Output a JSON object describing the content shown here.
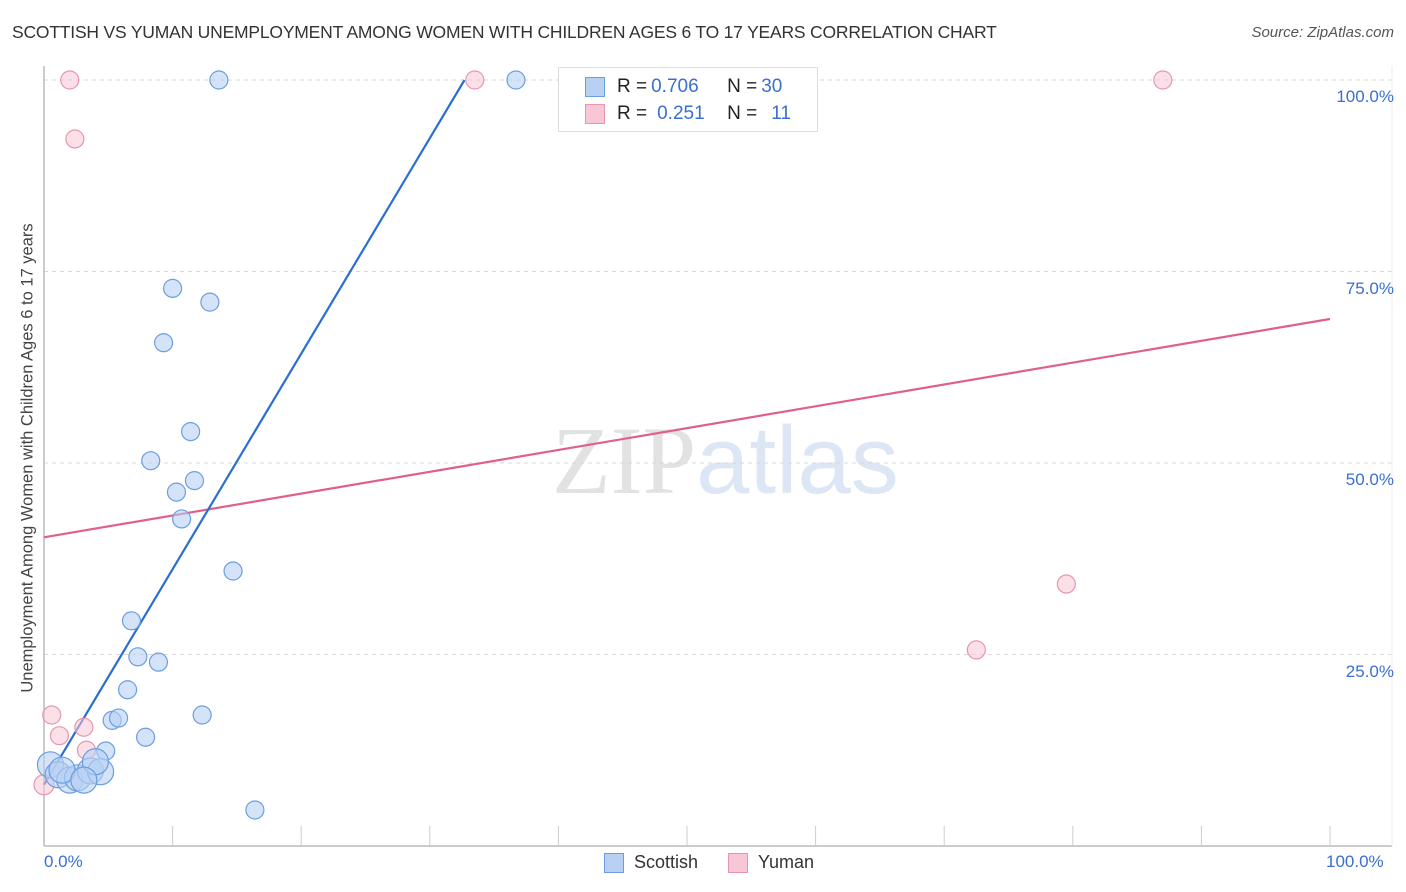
{
  "header": {
    "title": "SCOTTISH VS YUMAN UNEMPLOYMENT AMONG WOMEN WITH CHILDREN AGES 6 TO 17 YEARS CORRELATION CHART",
    "source": "Source: ZipAtlas.com"
  },
  "watermark": {
    "zip": "ZIP",
    "atlas": "atlas"
  },
  "legend": {
    "rows": [
      {
        "r_label": "R = ",
        "r_value": "0.706",
        "n_label": "N = ",
        "n_value": "30"
      },
      {
        "r_label": "R = ",
        "r_value": "0.251",
        "n_label": "N = ",
        "n_value": "11"
      }
    ]
  },
  "colors": {
    "scottish_fill": "#b8d1f3",
    "scottish_stroke": "#6a9ee0",
    "scottish_line": "#2a6fd0",
    "yuman_fill": "#f8c6d4",
    "yuman_stroke": "#e896b0",
    "yuman_line": "#e0608a",
    "tick_text": "#3a6fd0"
  },
  "chart_data": {
    "type": "scatter",
    "title": "SCOTTISH VS YUMAN UNEMPLOYMENT AMONG WOMEN WITH CHILDREN AGES 6 TO 17 YEARS CORRELATION CHART",
    "xlabel": "",
    "ylabel": "Unemployment Among Women with Children Ages 6 to 17 years",
    "xlim": [
      0,
      100
    ],
    "ylim": [
      0,
      100
    ],
    "x_tick_labels": [
      "0.0%",
      "100.0%"
    ],
    "y_ticks": [
      25,
      50,
      75,
      100
    ],
    "y_tick_labels": [
      "25.0%",
      "50.0%",
      "75.0%",
      "100.0%"
    ],
    "grid": true,
    "legend_position": "top-center",
    "series": [
      {
        "name": "Scottish",
        "r": 0.706,
        "n": 30,
        "points": [
          [
            13.6,
            100
          ],
          [
            36.7,
            100
          ],
          [
            10.0,
            72.8
          ],
          [
            12.9,
            71.0
          ],
          [
            9.3,
            65.7
          ],
          [
            11.4,
            54.1
          ],
          [
            8.3,
            50.3
          ],
          [
            10.3,
            46.2
          ],
          [
            11.7,
            47.7
          ],
          [
            10.7,
            42.7
          ],
          [
            14.7,
            35.9
          ],
          [
            6.8,
            29.4
          ],
          [
            7.3,
            24.7
          ],
          [
            8.9,
            24.0
          ],
          [
            6.5,
            20.4
          ],
          [
            5.3,
            16.4
          ],
          [
            5.8,
            16.7
          ],
          [
            7.9,
            14.2
          ],
          [
            12.3,
            17.1
          ],
          [
            4.8,
            12.4
          ],
          [
            16.4,
            4.7
          ],
          [
            0.5,
            10.6
          ],
          [
            1.1,
            9.3
          ],
          [
            2.0,
            8.6
          ],
          [
            2.6,
            8.9
          ],
          [
            3.6,
            9.8
          ],
          [
            4.4,
            9.7
          ],
          [
            1.4,
            9.9
          ],
          [
            4.0,
            11.0
          ],
          [
            3.1,
            8.6
          ]
        ],
        "trendline": {
          "x": [
            0,
            32.7
          ],
          "y": [
            8.0,
            100
          ]
        }
      },
      {
        "name": "Yuman",
        "r": 0.251,
        "n": 11,
        "points": [
          [
            2.0,
            100
          ],
          [
            33.5,
            100
          ],
          [
            87.0,
            100
          ],
          [
            2.4,
            92.3
          ],
          [
            79.5,
            34.2
          ],
          [
            72.5,
            25.6
          ],
          [
            0.6,
            17.1
          ],
          [
            3.1,
            15.5
          ],
          [
            1.2,
            14.4
          ],
          [
            3.3,
            12.5
          ],
          [
            0.0,
            8.0
          ]
        ],
        "trendline": {
          "x": [
            0,
            100
          ],
          "y": [
            40.3,
            68.8
          ]
        }
      }
    ]
  }
}
